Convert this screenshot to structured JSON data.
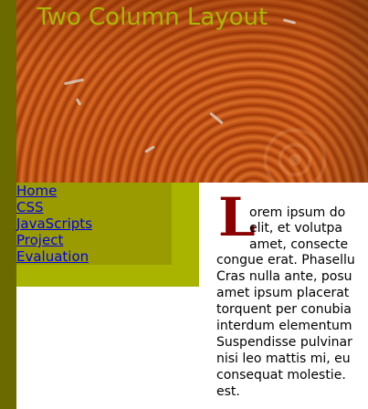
{
  "header": {
    "title": "Two Column Layout",
    "image": "tree-ring-wood-texture",
    "title_color": "#a9b800"
  },
  "nav": {
    "items": [
      {
        "label": "Home"
      },
      {
        "label": "CSS"
      },
      {
        "label": "JavaScripts"
      },
      {
        "label": "Project"
      },
      {
        "label": "Evaluation"
      }
    ],
    "colors": {
      "outer": "#a8b400",
      "inner": "#9a9b00",
      "link": "#0000ee"
    }
  },
  "content": {
    "drop_cap": "L",
    "drop_cap_color": "#8b0000",
    "lines": [
      "orem ipsum do",
      "elit, et volutpa",
      "amet, consecte",
      "congue erat. Phasellu",
      "Cras nulla ante, posu",
      "amet ipsum placerat",
      "torquent per conubia",
      "interdum elementum",
      "Suspendisse pulvinar",
      "nisi leo mattis mi, eu",
      "consequat molestie.",
      "est."
    ]
  },
  "sidebar_strip_color": "#6b6a00"
}
